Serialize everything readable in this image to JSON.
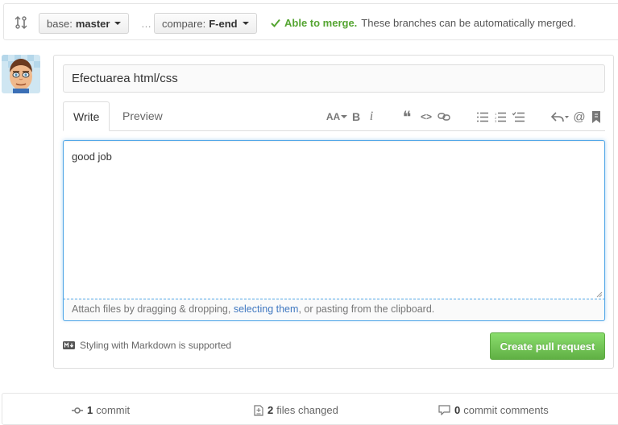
{
  "compare": {
    "base_prefix": "base:",
    "base_branch": "master",
    "ellipsis": "…",
    "compare_prefix": "compare:",
    "compare_branch": "F-end",
    "merge_ok": "Able to merge.",
    "merge_detail": "These branches can be automatically merged."
  },
  "form": {
    "title_value": "Efectuarea html/css",
    "tabs": [
      {
        "label": "Write",
        "active": true
      },
      {
        "label": "Preview",
        "active": false
      }
    ],
    "toolbar": {
      "text_size": "AA",
      "bold": "B",
      "italic": "i",
      "quote": "❝",
      "code": "<>",
      "mention": "@"
    },
    "body_value": "good job",
    "attach_before": "Attach files by dragging & dropping, ",
    "attach_link": "selecting them",
    "attach_after": ", or pasting from the clipboard.",
    "markdown_note": "Styling with Markdown is supported",
    "submit_label": "Create pull request"
  },
  "summary": {
    "commits_count": "1",
    "commits_label": "commit",
    "files_count": "2",
    "files_label": "files changed",
    "comments_count": "0",
    "comments_label": "commit comments"
  },
  "colors": {
    "merge_ok": "#55a532",
    "submit_green": "#60b044",
    "link_blue": "#4078c0",
    "focus_blue": "#51a7e8"
  }
}
